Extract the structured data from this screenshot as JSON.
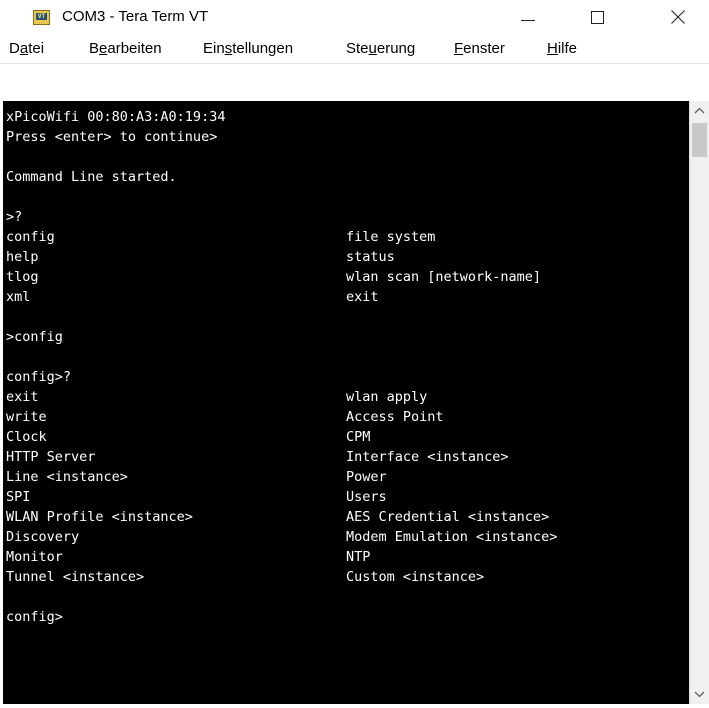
{
  "window": {
    "title": "COM3 - Tera Term VT",
    "icon_label": "VT",
    "icons": {
      "app": "tera-term-icon",
      "minimize": "minimize-icon",
      "maximize": "maximize-icon",
      "close": "close-icon"
    }
  },
  "menu": {
    "items": [
      {
        "pre": "D",
        "u": "a",
        "post": "tei"
      },
      {
        "pre": "B",
        "u": "e",
        "post": "arbeiten"
      },
      {
        "pre": "Ein",
        "u": "s",
        "post": "tellungen"
      },
      {
        "pre": "Ste",
        "u": "u",
        "post": "erung"
      },
      {
        "pre": "",
        "u": "F",
        "post": "enster"
      },
      {
        "pre": "",
        "u": "H",
        "post": "ilfe"
      }
    ]
  },
  "terminal": {
    "lines": [
      {
        "a": "xPicoWifi 00:80:A3:A0:19:34",
        "b": ""
      },
      {
        "a": "Press <enter> to continue>",
        "b": ""
      },
      {
        "a": "",
        "b": ""
      },
      {
        "a": "Command Line started.",
        "b": ""
      },
      {
        "a": "",
        "b": ""
      },
      {
        "a": ">?",
        "b": ""
      },
      {
        "a": "config",
        "b": "file system"
      },
      {
        "a": "help",
        "b": "status"
      },
      {
        "a": "tlog",
        "b": "wlan scan [network-name]"
      },
      {
        "a": "xml",
        "b": "exit"
      },
      {
        "a": "",
        "b": ""
      },
      {
        "a": ">config",
        "b": ""
      },
      {
        "a": "",
        "b": ""
      },
      {
        "a": "config>?",
        "b": ""
      },
      {
        "a": "exit",
        "b": "wlan apply"
      },
      {
        "a": "write",
        "b": "Access Point"
      },
      {
        "a": "Clock",
        "b": "CPM"
      },
      {
        "a": "HTTP Server",
        "b": "Interface <instance>"
      },
      {
        "a": "Line <instance>",
        "b": "Power"
      },
      {
        "a": "SPI",
        "b": "Users"
      },
      {
        "a": "WLAN Profile <instance>",
        "b": "AES Credential <instance>"
      },
      {
        "a": "Discovery",
        "b": "Modem Emulation <instance>"
      },
      {
        "a": "Monitor",
        "b": "NTP"
      },
      {
        "a": "Tunnel <instance>",
        "b": "Custom <instance>"
      },
      {
        "a": "",
        "b": ""
      },
      {
        "a": "config>",
        "b": ""
      }
    ]
  },
  "scrollbar": {
    "position": 0
  }
}
